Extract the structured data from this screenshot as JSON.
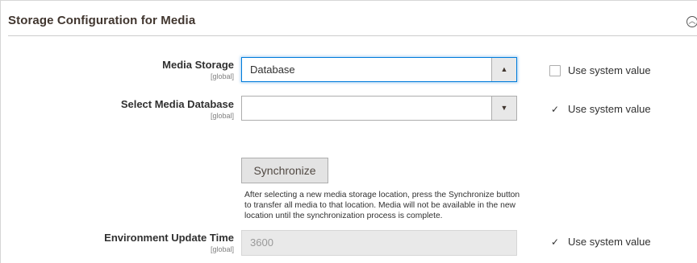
{
  "section": {
    "title": "Storage Configuration for Media",
    "collapse_icon": "chevron-up-circle-icon"
  },
  "fields": {
    "media_storage": {
      "label": "Media Storage",
      "scope": "[global]",
      "value": "Database",
      "arrow": "▲",
      "use_system_value": {
        "label": "Use system value",
        "checked": false
      }
    },
    "media_database": {
      "label": "Select Media Database",
      "scope": "[global]",
      "value": "",
      "arrow": "▼",
      "use_system_value": {
        "label": "Use system value",
        "checked": true
      }
    },
    "synchronize": {
      "button_label": "Synchronize",
      "note": "After selecting a new media storage location, press the Synchronize button to transfer all media to that location. Media will not be available in the new location until the synchronization process is complete."
    },
    "environment_update_time": {
      "label": "Environment Update Time",
      "scope": "[global]",
      "value": "3600",
      "use_system_value": {
        "label": "Use system value",
        "checked": true
      }
    }
  },
  "colors": {
    "focus_border": "#007bdb",
    "button_bg": "#e3e3e3",
    "disabled_input_bg": "#e9e9e9"
  }
}
